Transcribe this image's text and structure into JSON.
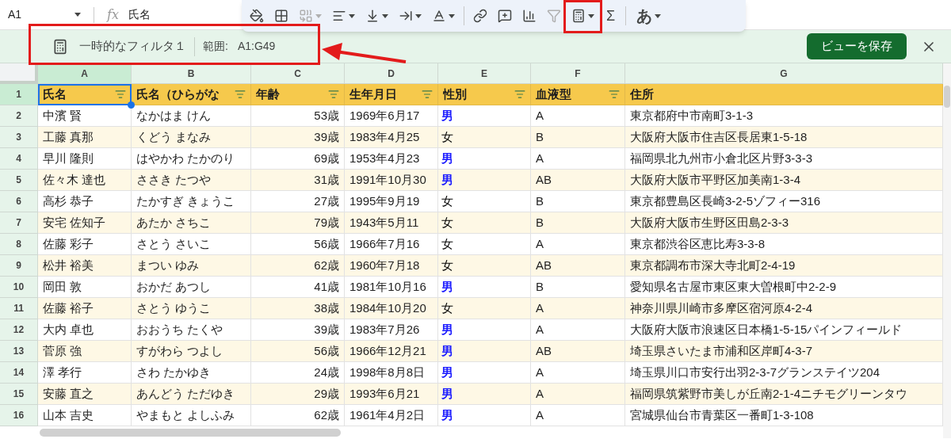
{
  "formula_bar": {
    "cell_ref": "A1",
    "fx": "fx",
    "value": "氏名"
  },
  "toolbar": [
    {
      "kind": "fill",
      "disabled": false,
      "dropdown": false
    },
    {
      "kind": "borders",
      "disabled": false,
      "dropdown": false
    },
    {
      "kind": "merge",
      "disabled": true,
      "dropdown": true
    },
    {
      "kind": "align",
      "disabled": false,
      "dropdown": true
    },
    {
      "kind": "valign",
      "disabled": false,
      "dropdown": true
    },
    {
      "kind": "wrap",
      "disabled": false,
      "dropdown": true
    },
    {
      "kind": "textcolor",
      "disabled": false,
      "dropdown": true
    },
    {
      "kind": "divider"
    },
    {
      "kind": "link",
      "disabled": false,
      "dropdown": false
    },
    {
      "kind": "comment",
      "disabled": false,
      "dropdown": false
    },
    {
      "kind": "chart",
      "disabled": false,
      "dropdown": false
    },
    {
      "kind": "filter",
      "disabled": true,
      "dropdown": false
    },
    {
      "kind": "filterview",
      "disabled": false,
      "dropdown": true
    },
    {
      "kind": "sum",
      "label": "Σ",
      "disabled": false,
      "dropdown": false
    },
    {
      "kind": "divider"
    },
    {
      "kind": "input",
      "label": "あ",
      "disabled": false,
      "dropdown": true
    }
  ],
  "filter_bar": {
    "name": "一時的なフィルタ１",
    "range_label": "範囲:",
    "range": "A1:G49",
    "save_button": "ビューを保存"
  },
  "columns": [
    {
      "letter": "A",
      "selected": true
    },
    {
      "letter": "B",
      "selected": false
    },
    {
      "letter": "C",
      "selected": false
    },
    {
      "letter": "D",
      "selected": false
    },
    {
      "letter": "E",
      "selected": false
    },
    {
      "letter": "F",
      "selected": false
    },
    {
      "letter": "G",
      "selected": false
    }
  ],
  "header_row": {
    "number": "1",
    "selected": true,
    "cells": [
      {
        "text": "氏名",
        "filter": true
      },
      {
        "text": "氏名（ひらがな",
        "filter": true
      },
      {
        "text": "年齢",
        "filter": true
      },
      {
        "text": "生年月日",
        "filter": true
      },
      {
        "text": "性別",
        "filter": true
      },
      {
        "text": "血液型",
        "filter": true
      },
      {
        "text": "住所",
        "filter": false
      }
    ]
  },
  "rows": [
    {
      "number": "2",
      "selected": false,
      "name": "中濱 賢",
      "kana": "なかはま けん",
      "age": "53歳",
      "birth": "1969年6月17",
      "gender": {
        "text": "男",
        "color": "#1a1aff",
        "bold": true
      },
      "blood": "A",
      "address": "東京都府中市南町3-1-3"
    },
    {
      "number": "3",
      "selected": false,
      "name": "工藤 真那",
      "kana": "くどう まなみ",
      "age": "39歳",
      "birth": "1983年4月25",
      "gender": {
        "text": "女",
        "color": "#000000",
        "bold": false
      },
      "blood": "B",
      "address": "大阪府大阪市住吉区長居東1-5-18"
    },
    {
      "number": "4",
      "selected": false,
      "name": "早川 隆則",
      "kana": "はやかわ たかのり",
      "age": "69歳",
      "birth": "1953年4月23",
      "gender": {
        "text": "男",
        "color": "#1a1aff",
        "bold": true
      },
      "blood": "A",
      "address": "福岡県北九州市小倉北区片野3-3-3"
    },
    {
      "number": "5",
      "selected": false,
      "name": "佐々木 達也",
      "kana": "ささき たつや",
      "age": "31歳",
      "birth": "1991年10月30",
      "gender": {
        "text": "男",
        "color": "#1a1aff",
        "bold": true
      },
      "blood": "AB",
      "address": "大阪府大阪市平野区加美南1-3-4"
    },
    {
      "number": "6",
      "selected": false,
      "name": "高杉 恭子",
      "kana": "たかすぎ きょうこ",
      "age": "27歳",
      "birth": "1995年9月19",
      "gender": {
        "text": "女",
        "color": "#000000",
        "bold": false
      },
      "blood": "B",
      "address": "東京都豊島区長崎3-2-5ゾフィー316"
    },
    {
      "number": "7",
      "selected": false,
      "name": "安宅 佐知子",
      "kana": "あたか さちこ",
      "age": "79歳",
      "birth": "1943年5月11",
      "gender": {
        "text": "女",
        "color": "#000000",
        "bold": false
      },
      "blood": "B",
      "address": "大阪府大阪市生野区田島2-3-3"
    },
    {
      "number": "8",
      "selected": false,
      "name": "佐藤 彩子",
      "kana": "さとう さいこ",
      "age": "56歳",
      "birth": "1966年7月16",
      "gender": {
        "text": "女",
        "color": "#000000",
        "bold": false
      },
      "blood": "A",
      "address": "東京都渋谷区恵比寿3-3-8"
    },
    {
      "number": "9",
      "selected": false,
      "name": "松井 裕美",
      "kana": "まつい ゆみ",
      "age": "62歳",
      "birth": "1960年7月18",
      "gender": {
        "text": "女",
        "color": "#000000",
        "bold": false
      },
      "blood": "AB",
      "address": "東京都調布市深大寺北町2-4-19"
    },
    {
      "number": "10",
      "selected": false,
      "name": "岡田 敦",
      "kana": "おかだ あつし",
      "age": "41歳",
      "birth": "1981年10月16",
      "gender": {
        "text": "男",
        "color": "#1a1aff",
        "bold": true
      },
      "blood": "B",
      "address": "愛知県名古屋市東区東大曽根町中2-2-9"
    },
    {
      "number": "11",
      "selected": false,
      "name": "佐藤 裕子",
      "kana": "さとう ゆうこ",
      "age": "38歳",
      "birth": "1984年10月20",
      "gender": {
        "text": "女",
        "color": "#000000",
        "bold": false
      },
      "blood": "A",
      "address": "神奈川県川崎市多摩区宿河原4-2-4"
    },
    {
      "number": "12",
      "selected": false,
      "name": "大内 卓也",
      "kana": "おおうち たくや",
      "age": "39歳",
      "birth": "1983年7月26",
      "gender": {
        "text": "男",
        "color": "#1a1aff",
        "bold": true
      },
      "blood": "A",
      "address": "大阪府大阪市浪速区日本橋1-5-15パインフィールド"
    },
    {
      "number": "13",
      "selected": false,
      "name": "菅原 強",
      "kana": "すがわら つよし",
      "age": "56歳",
      "birth": "1966年12月21",
      "gender": {
        "text": "男",
        "color": "#1a1aff",
        "bold": true
      },
      "blood": "AB",
      "address": "埼玉県さいたま市浦和区岸町4-3-7"
    },
    {
      "number": "14",
      "selected": false,
      "name": "澤 孝行",
      "kana": "さわ たかゆき",
      "age": "24歳",
      "birth": "1998年8月8日",
      "gender": {
        "text": "男",
        "color": "#1a1aff",
        "bold": true
      },
      "blood": "A",
      "address": "埼玉県川口市安行出羽2-3-7グランステイツ204"
    },
    {
      "number": "15",
      "selected": false,
      "name": "安藤 直之",
      "kana": "あんどう ただゆき",
      "age": "29歳",
      "birth": "1993年6月21",
      "gender": {
        "text": "男",
        "color": "#1a1aff",
        "bold": true
      },
      "blood": "A",
      "address": "福岡県筑紫野市美しが丘南2-1-4ニチモグリーンタウ"
    },
    {
      "number": "16",
      "selected": false,
      "name": "山本 吉史",
      "kana": "やまもと よしふみ",
      "age": "62歳",
      "birth": "1961年4月2日",
      "gender": {
        "text": "男",
        "color": "#1a1aff",
        "bold": true
      },
      "blood": "A",
      "address": "宮城県仙台市青葉区一番町1-3-108"
    }
  ]
}
